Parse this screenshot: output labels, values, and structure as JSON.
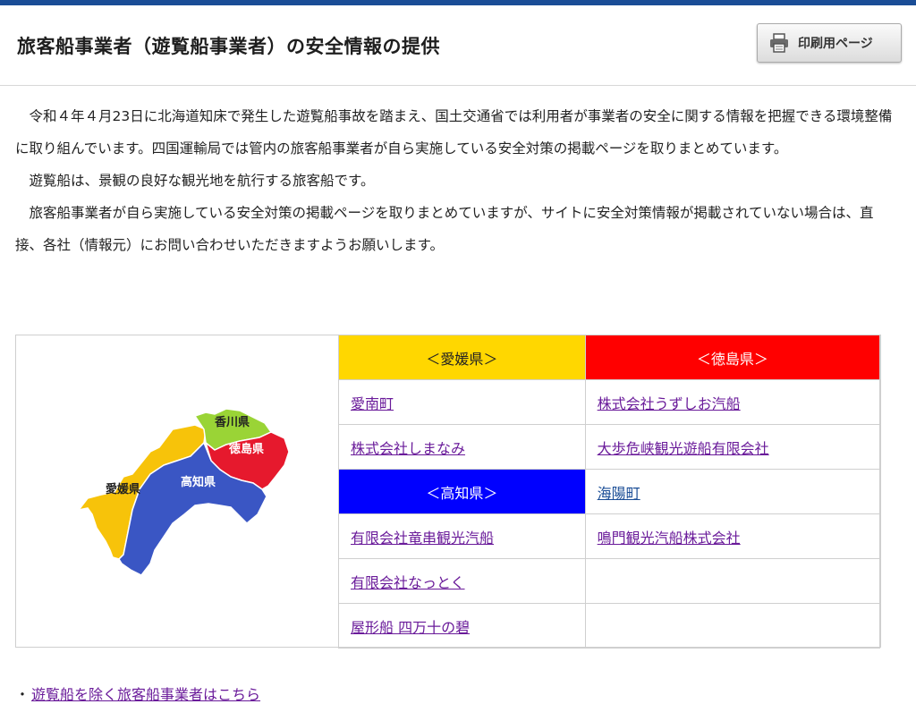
{
  "header": {
    "title": "旅客船事業者（遊覧船事業者）の安全情報の提供",
    "print_label": "印刷用ページ"
  },
  "intro": {
    "p1": "令和４年４月23日に北海道知床で発生した遊覧船事故を踏まえ、国土交通省では利用者が事業者の安全に関する情報を把握できる環境整備に取り組んでいます。四国運輸局では管内の旅客船事業者が自ら実施している安全対策の掲載ページを取りまとめています。",
    "p2": "遊覧船は、景観の良好な観光地を航行する旅客船です。",
    "p3": "旅客船事業者が自ら実施している安全対策の掲載ページを取りまとめていますが、サイトに安全対策情報が掲載されていない場合は、直接、各社（情報元）にお問い合わせいただきますようお願いします。"
  },
  "map": {
    "kagawa": "香川県",
    "tokushima": "徳島県",
    "kochi": "高知県",
    "ehime": "愛媛県"
  },
  "table": {
    "ehime_header": "＜愛媛県＞",
    "tokushima_header": "＜徳島県＞",
    "kochi_header": "＜高知県＞",
    "ehime_items": [
      "愛南町",
      "株式会社しまなみ"
    ],
    "kochi_items": [
      "有限会社竜串観光汽船",
      "有限会社なっとく",
      "屋形船 四万十の碧"
    ],
    "tokushima_items": [
      "株式会社うずしお汽船",
      "大歩危峡観光遊船有限会社",
      "海陽町",
      "鳴門観光汽船株式会社"
    ]
  },
  "colors": {
    "ehime": "#ffd700",
    "tokushima": "#ff0000",
    "kochi": "#0000ff",
    "kagawa": "#9acd32"
  },
  "footer": {
    "bullet": "・",
    "link": "遊覧船を除く旅客船事業者はこちら"
  }
}
